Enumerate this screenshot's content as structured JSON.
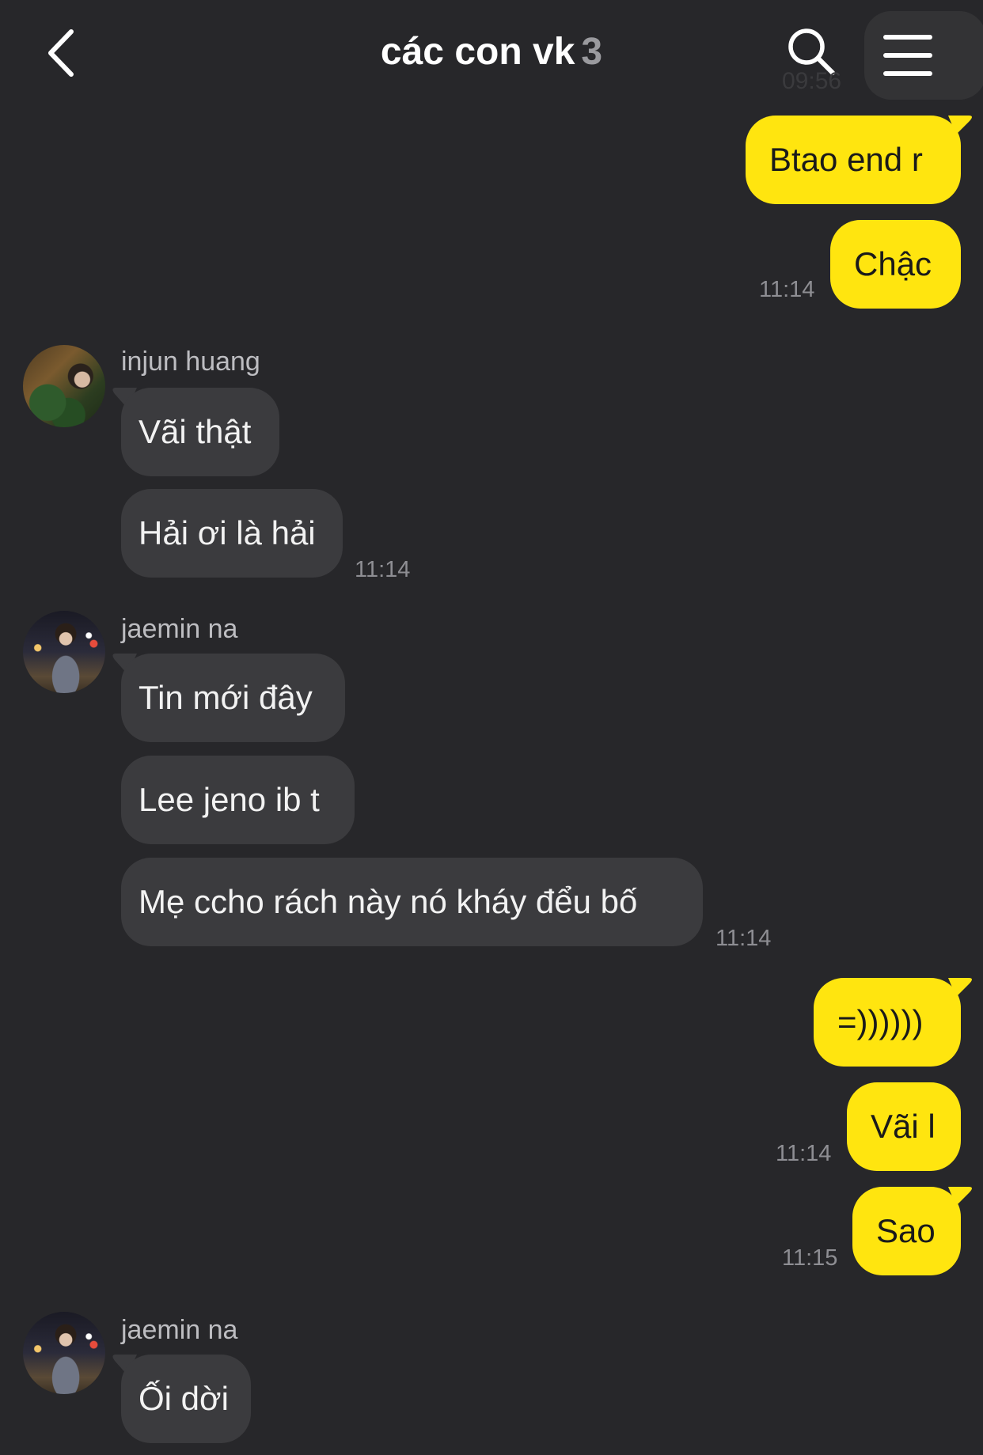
{
  "header": {
    "title": "các con vk",
    "member_count": "3",
    "back_icon": "chevron-left-icon",
    "search_icon": "search-icon",
    "menu_icon": "hamburger-menu-icon",
    "faded_timestamp": "09:56"
  },
  "messages": {
    "out1": {
      "text": "Btao end r"
    },
    "out2": {
      "text": "Chậc",
      "time": "11:14"
    },
    "group1": {
      "sender": "injun huang",
      "m1": "Vãi thật",
      "m2": "Hải ơi là hải",
      "time": "11:14"
    },
    "group2": {
      "sender": "jaemin na",
      "m1": "Tin mới đây",
      "m2": "Lee jeno ib t",
      "m3": "Mẹ ccho rách này nó kháy đểu bố",
      "time": "11:14"
    },
    "out3": {
      "text": "=))))))"
    },
    "out4": {
      "text": "Vãi l",
      "time": "11:14"
    },
    "out5": {
      "text": "Sao",
      "time": "11:15"
    },
    "group3": {
      "sender": "jaemin na",
      "m1": "Ối dời"
    }
  },
  "colors": {
    "background": "#27272a",
    "outgoing_bubble": "#ffe50f",
    "incoming_bubble": "#3b3b3e",
    "timestamp": "#8e8e93"
  }
}
